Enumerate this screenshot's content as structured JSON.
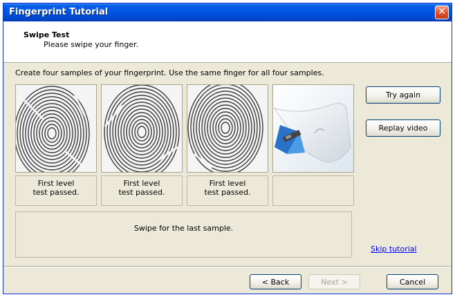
{
  "window": {
    "title": "Fingerprint Tutorial"
  },
  "header": {
    "title": "Swipe Test",
    "subtitle": "Please swipe your finger."
  },
  "instructions": "Create four samples of your fingerprint. Use the same finger for all four samples.",
  "samples": [
    {
      "status": "captured",
      "caption_line1": "First level",
      "caption_line2": "test passed."
    },
    {
      "status": "captured",
      "caption_line1": "First level",
      "caption_line2": "test passed."
    },
    {
      "status": "captured",
      "caption_line1": "First level",
      "caption_line2": "test passed."
    },
    {
      "status": "awaiting-swipe",
      "caption_line1": "",
      "caption_line2": ""
    }
  ],
  "status_message": "Swipe for the last sample.",
  "side_buttons": {
    "try_again": "Try again",
    "replay_video": "Replay video"
  },
  "skip_link": "Skip tutorial",
  "footer": {
    "back": "< Back",
    "next": "Next >",
    "cancel": "Cancel",
    "next_enabled": false
  },
  "colors": {
    "title_bar": "#0054e3",
    "dialog_background": "#ece9d8",
    "link": "#0000ff",
    "close_button": "#e35a34"
  },
  "icons": {
    "close": "close-icon",
    "sensor_illustration": "swipe-sensor-icon"
  }
}
